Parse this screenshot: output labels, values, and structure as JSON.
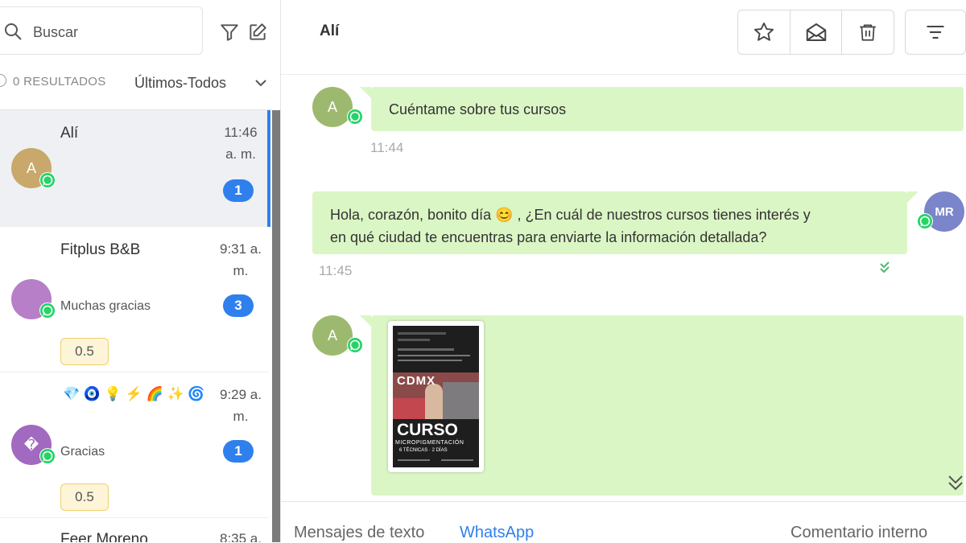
{
  "sidebar": {
    "search_placeholder": "Buscar",
    "results_count": "0 RESULTADOS",
    "filter_label": "Últimos-Todos",
    "conversations": [
      {
        "name": "Alí",
        "time": "11:46 a. m.",
        "time_line1": "11:46",
        "time_line2": "a. m.",
        "avatar_letter": "A",
        "avatar_color": "#c8a86b",
        "unread": "1",
        "preview": "",
        "score": ""
      },
      {
        "name": "Fitplus B&B",
        "time": "9:31 a. m.",
        "time_line1": "9:31 a.",
        "time_line2": "m.",
        "avatar_letter": "",
        "avatar_color": "#b77fc7",
        "unread": "3",
        "preview": "Muchas gracias",
        "score": "0.5"
      },
      {
        "name": "💎 🧿 💡 ⚡ 🌈 ✨ 🌀",
        "time": "9:29 a. m.",
        "time_line1": "9:29 a.",
        "time_line2": "m.",
        "avatar_letter": "�",
        "avatar_color": "#a169c0",
        "unread": "1",
        "preview": "Gracias",
        "score": "0.5"
      },
      {
        "name": "Feer Moreno",
        "time": "8:35 a.",
        "time_line1": "8:35 a.",
        "time_line2": "",
        "avatar_letter": "",
        "avatar_color": "#8ab07a",
        "unread": "",
        "preview": "",
        "score": ""
      }
    ]
  },
  "chat": {
    "title": "Alí",
    "messages": [
      {
        "direction": "in",
        "avatar": "A",
        "avatar_color": "#9db96f",
        "text": "Cuéntame sobre tus cursos",
        "time": "11:44"
      },
      {
        "direction": "out",
        "avatar": "MR",
        "avatar_color": "#7a86c9",
        "text_line1": "Hola, corazón, bonito día 😊 , ¿En cuál de nuestros cursos tienes interés y",
        "text_line2": "en qué ciudad te encuentras para enviarte la información detallada?",
        "time": "11:45",
        "status": "read"
      },
      {
        "direction": "in",
        "avatar": "A",
        "avatar_color": "#9db96f",
        "type": "image",
        "image_text_1": "CDMX",
        "image_text_2": "CURSO",
        "image_text_3": "MICROPIGMENTACIÓN",
        "image_text_4": "6 TÉCNICAS · 2 DÍAS"
      }
    ]
  },
  "composer": {
    "tab_text": "Mensajes de texto",
    "tab_whatsapp": "WhatsApp",
    "tab_internal": "Comentario interno"
  },
  "colors": {
    "accent": "#2f80ed",
    "bubble": "#dbf6c5",
    "whatsapp": "#25d366"
  },
  "icons": [
    "search-icon",
    "filter-icon",
    "edit-icon",
    "chevron-down-icon",
    "star-icon",
    "envelope-open-icon",
    "trash-icon",
    "sort-icon",
    "whatsapp-icon",
    "double-check-icon",
    "double-chevron-down-icon"
  ]
}
